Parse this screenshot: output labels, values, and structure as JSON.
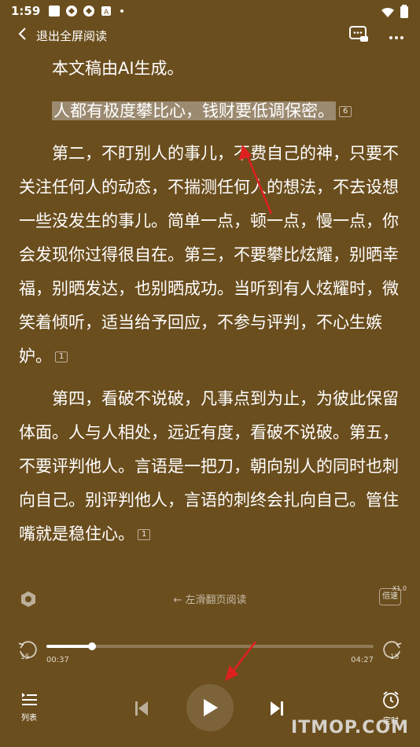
{
  "status_bar": {
    "time": "1:59",
    "icons": [
      "app-notification-icon",
      "app-icon-1",
      "app-icon-2",
      "app-icon-3",
      "dot-icon"
    ],
    "right_icons": [
      "wifi-icon",
      "battery-icon"
    ]
  },
  "top_bar": {
    "back_label": "退出全屏阅读",
    "right_icons": [
      "comment-ai-icon",
      "more-icon"
    ]
  },
  "content": {
    "intro": "本文稿由AI生成。",
    "highlight_sentence": "人都有极度攀比心，钱财要低调保密。",
    "highlight_badge": "6",
    "para2": "第二，不盯别人的事儿，不费自己的神，只要不关注任何人的动态，不揣测任何人的想法，不去设想一些没发生的事儿。简单一点，顿一点，慢一点，你会发现你过得很自在。第三，不要攀比炫耀，别晒幸福，别晒发达，也别晒成功。当听到有人炫耀时，微笑着倾听，适当给予回应，不参与评判，不心生嫉妒。",
    "para2_badge": "1",
    "para3": "第四，看破不说破，凡事点到为止，为彼此保留体面。人与人相处，远近有度，看破不说破。第五，不要评判他人。言语是一把刀，朝向别人的同时也刺向自己。别评判他人，言语的刺终会扎向自己。管住嘴就是稳住心。",
    "para3_badge": "1"
  },
  "mid_bar": {
    "hint": "← 左滑翻页阅读",
    "speed_label": "倍速",
    "speed_value": "X1.0"
  },
  "player": {
    "progress": 0.14,
    "time_current": "00:37",
    "time_total": "04:27",
    "skip_back": "15",
    "skip_forward": "15",
    "list_label": "列表",
    "timer_label": "定时"
  },
  "watermark": "ITMOP.COM",
  "colors": {
    "background": "#6b4e1e",
    "highlight": "#9b8a70",
    "arrow": "#e02020"
  }
}
